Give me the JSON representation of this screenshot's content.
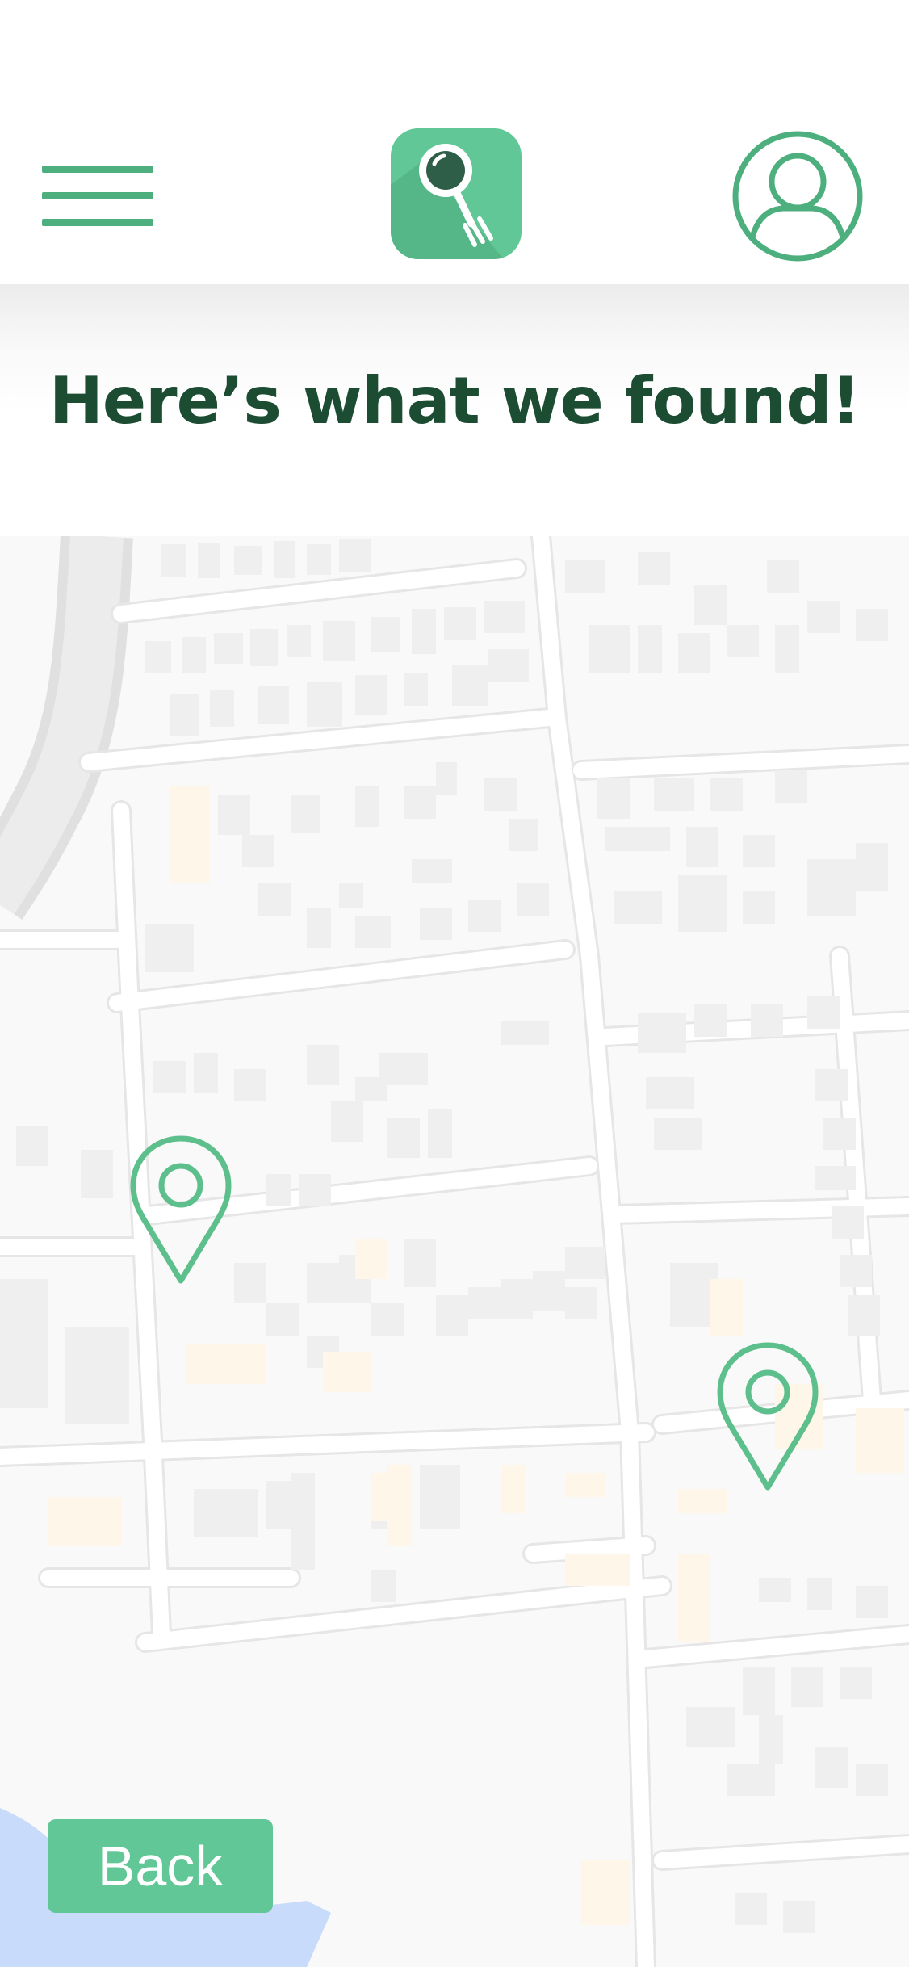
{
  "header": {
    "menu_icon": "hamburger-menu-icon",
    "logo_icon": "magnifier-fork-logo-icon",
    "profile_icon": "user-profile-icon"
  },
  "page": {
    "heading": "Here’s what we found!"
  },
  "map": {
    "pins": [
      {
        "icon": "location-pin-icon"
      },
      {
        "icon": "location-pin-icon"
      }
    ]
  },
  "footer": {
    "back_label": "Back"
  },
  "colors": {
    "accent": "#62c796",
    "accent_dark": "#4caf7d",
    "heading": "#1c4d33",
    "water": "#c9dbfb"
  }
}
